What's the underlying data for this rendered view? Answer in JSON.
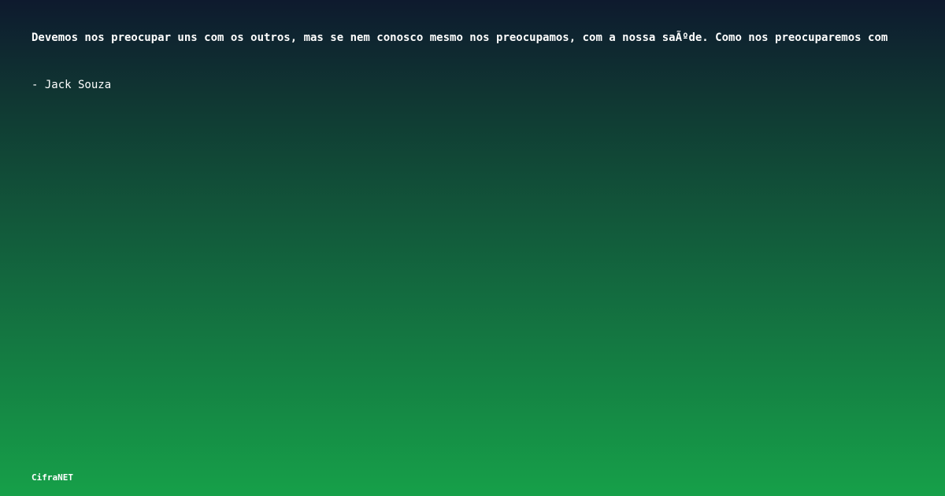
{
  "quote": {
    "text": "Devemos nos preocupar uns com os outros, mas se nem conosco mesmo nos preocupamos, com a nossa saÃºde. Como nos preocuparemos com"
  },
  "author": {
    "line": "- Jack Souza"
  },
  "brand": {
    "name": "CifraNET"
  }
}
